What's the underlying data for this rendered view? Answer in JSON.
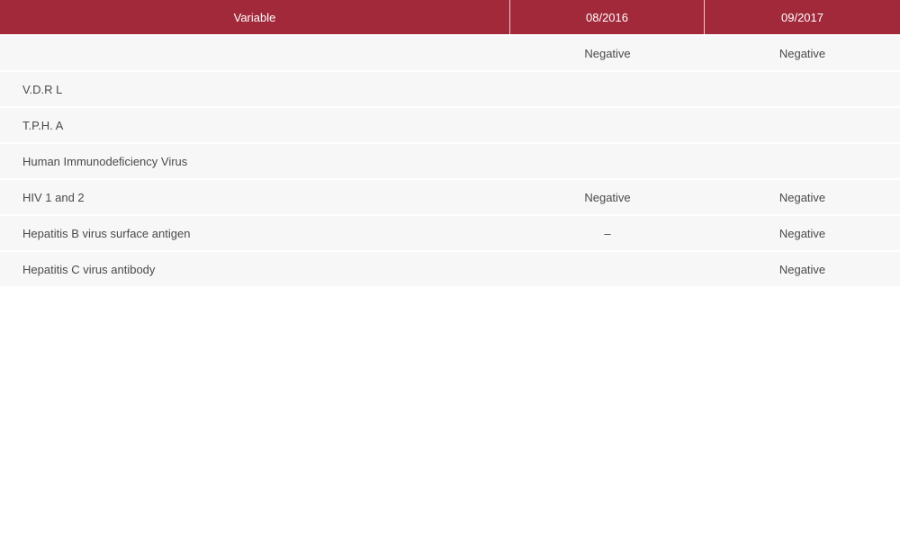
{
  "table": {
    "headers": [
      "Variable",
      "08/2016",
      "09/2017"
    ],
    "rows": [
      [
        "",
        "Negative",
        "Negative"
      ],
      [
        "V.D.R L",
        "",
        ""
      ],
      [
        "T.P.H. A",
        "",
        ""
      ],
      [
        "Human Immunodeficiency Virus",
        "",
        ""
      ],
      [
        "HIV 1 and 2",
        "Negative",
        "Negative"
      ],
      [
        "Hepatitis B virus surface antigen",
        "–",
        "Negative"
      ],
      [
        "Hepatitis C virus antibody",
        "",
        "Negative"
      ]
    ]
  }
}
